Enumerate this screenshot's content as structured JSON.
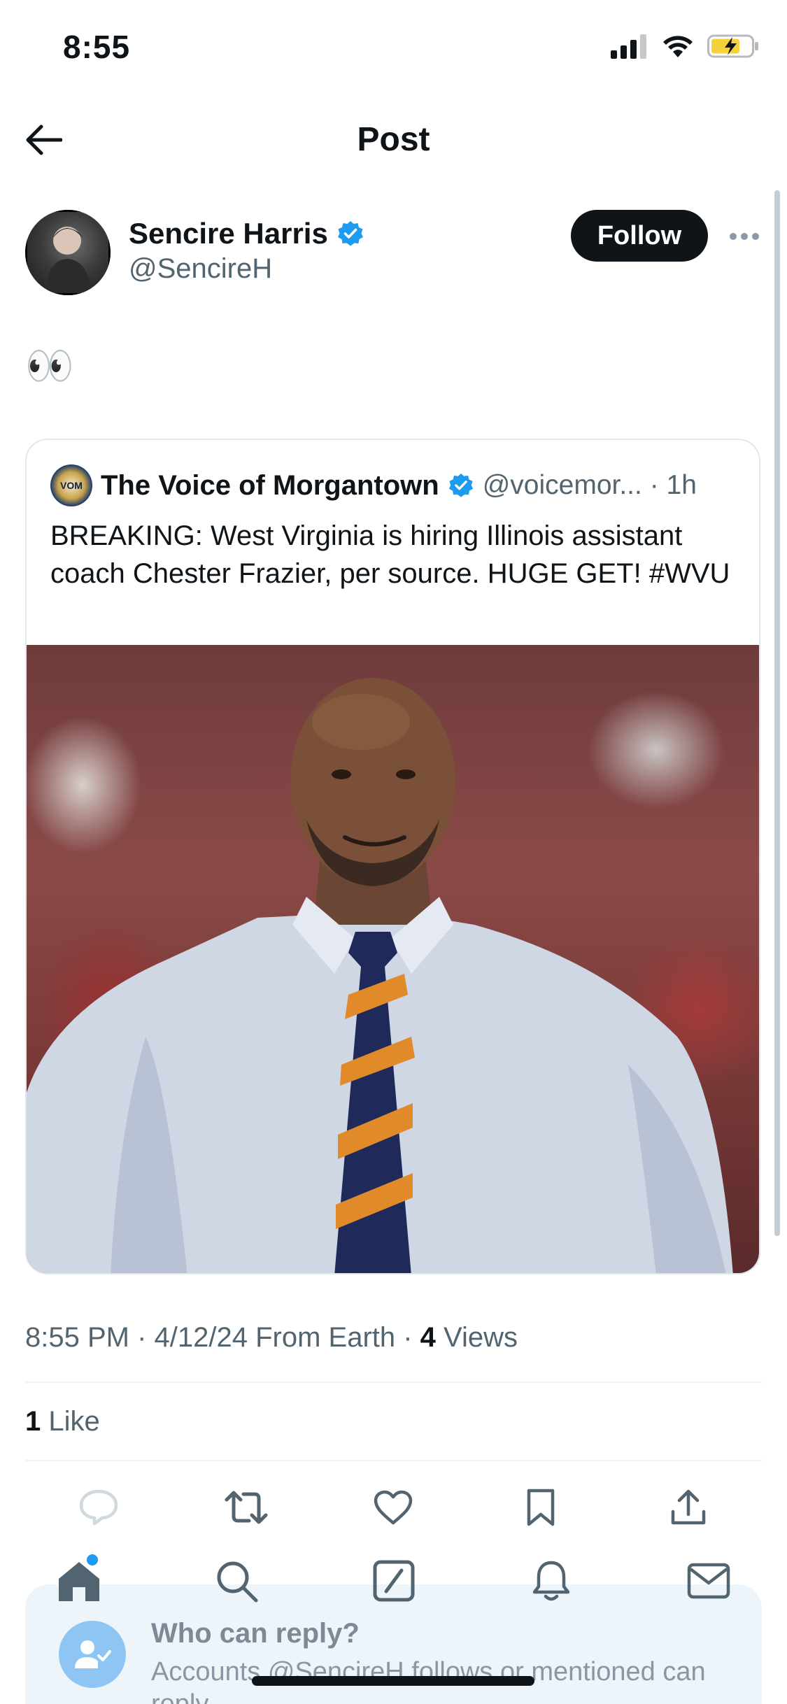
{
  "status_bar": {
    "time": "8:55"
  },
  "nav": {
    "title": "Post"
  },
  "author": {
    "name": "Sencire Harris",
    "handle": "@SencireH",
    "follow_label": "Follow"
  },
  "post": {
    "text": "👀"
  },
  "quoted": {
    "name": "The Voice of Morgantown",
    "handle_time": "@voicemor... · 1h",
    "avatar_text": "VOM",
    "text": "BREAKING: West Virginia is hiring Illinois assistant coach Chester Frazier, per source. HUGE GET! #WVU"
  },
  "meta": {
    "time_date": "8:55 PM · 4/12/24 From Earth · ",
    "views_count": "4",
    "views_label": " Views"
  },
  "likes": {
    "count": "1",
    "label": " Like"
  },
  "reply_panel": {
    "title": "Who can reply?",
    "subtitle": "Accounts @SencireH follows or mentioned can reply"
  },
  "colors": {
    "accent": "#1d9bf0",
    "text": "#0f1419",
    "muted": "#536471"
  }
}
